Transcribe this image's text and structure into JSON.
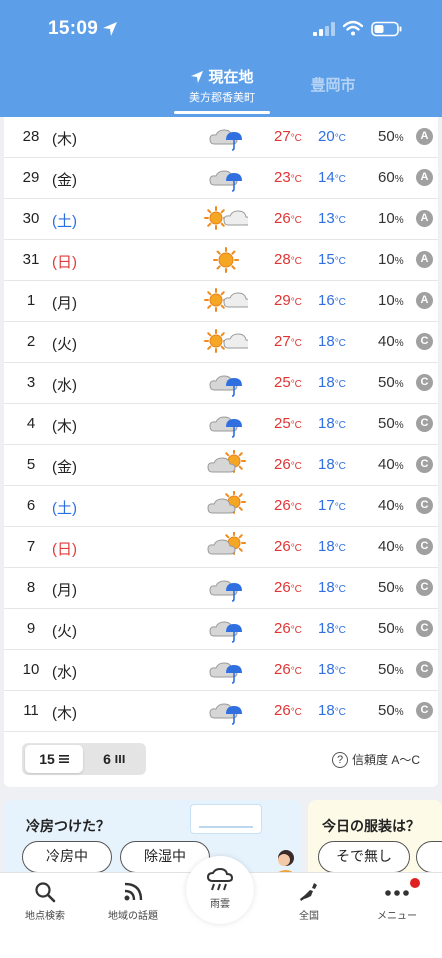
{
  "status": {
    "time": "15:09"
  },
  "header": {
    "current_tab_label": "現在地",
    "current_tab_sublabel": "美方郡香美町",
    "other_tab_label": "豊岡市"
  },
  "forecast": {
    "temp_unit": "°C",
    "pop_unit": "%",
    "rows": [
      {
        "day": "28",
        "weekday": "(木)",
        "wd": "weekday",
        "icon": "cloud-rain-icon",
        "high": "27",
        "low": "20",
        "pop": "50",
        "reliability": "A"
      },
      {
        "day": "29",
        "weekday": "(金)",
        "wd": "weekday",
        "icon": "cloud-rain-icon",
        "high": "23",
        "low": "14",
        "pop": "60",
        "reliability": "A"
      },
      {
        "day": "30",
        "weekday": "(土)",
        "wd": "sat",
        "icon": "sun-cloud-icon",
        "high": "26",
        "low": "13",
        "pop": "10",
        "reliability": "A"
      },
      {
        "day": "31",
        "weekday": "(日)",
        "wd": "sun",
        "icon": "sun-icon",
        "high": "28",
        "low": "15",
        "pop": "10",
        "reliability": "A"
      },
      {
        "day": "1",
        "weekday": "(月)",
        "wd": "weekday",
        "icon": "sun-cloud-icon",
        "high": "29",
        "low": "16",
        "pop": "10",
        "reliability": "A"
      },
      {
        "day": "2",
        "weekday": "(火)",
        "wd": "weekday",
        "icon": "sun-cloud-icon",
        "high": "27",
        "low": "18",
        "pop": "40",
        "reliability": "C"
      },
      {
        "day": "3",
        "weekday": "(水)",
        "wd": "weekday",
        "icon": "cloud-rain-icon",
        "high": "25",
        "low": "18",
        "pop": "50",
        "reliability": "C"
      },
      {
        "day": "4",
        "weekday": "(木)",
        "wd": "weekday",
        "icon": "cloud-rain-icon",
        "high": "25",
        "low": "18",
        "pop": "50",
        "reliability": "C"
      },
      {
        "day": "5",
        "weekday": "(金)",
        "wd": "weekday",
        "icon": "cloud-sun-icon",
        "high": "26",
        "low": "18",
        "pop": "40",
        "reliability": "C"
      },
      {
        "day": "6",
        "weekday": "(土)",
        "wd": "sat",
        "icon": "cloud-sun-icon",
        "high": "26",
        "low": "17",
        "pop": "40",
        "reliability": "C"
      },
      {
        "day": "7",
        "weekday": "(日)",
        "wd": "sun",
        "icon": "cloud-sun-icon",
        "high": "26",
        "low": "18",
        "pop": "40",
        "reliability": "C"
      },
      {
        "day": "8",
        "weekday": "(月)",
        "wd": "weekday",
        "icon": "cloud-rain-icon",
        "high": "26",
        "low": "18",
        "pop": "50",
        "reliability": "C"
      },
      {
        "day": "9",
        "weekday": "(火)",
        "wd": "weekday",
        "icon": "cloud-rain-icon",
        "high": "26",
        "low": "18",
        "pop": "50",
        "reliability": "C"
      },
      {
        "day": "10",
        "weekday": "(水)",
        "wd": "weekday",
        "icon": "cloud-rain-icon",
        "high": "26",
        "low": "18",
        "pop": "50",
        "reliability": "C"
      },
      {
        "day": "11",
        "weekday": "(木)",
        "wd": "weekday",
        "icon": "cloud-rain-icon",
        "high": "26",
        "low": "18",
        "pop": "50",
        "reliability": "C"
      }
    ]
  },
  "controls": {
    "toggle_15": "15",
    "toggle_6": "6",
    "reliability_label": "信頼度 A～C"
  },
  "banners": {
    "ac": {
      "title": "冷房つけた？",
      "button1": "冷房中",
      "button2": "除湿中"
    },
    "clothes": {
      "title": "今日の服装は？",
      "button1": "そで無し"
    }
  },
  "nav": {
    "search": "地点検索",
    "topics": "地域の話題",
    "rain": "雨雲",
    "national": "全国",
    "menu": "メニュー"
  },
  "colors": {
    "header_bg": "#5c9ee8",
    "high_temp": "#e03535",
    "low_temp": "#2f6fe0",
    "saturday": "#2b6ee0",
    "sunday": "#e03a3a"
  }
}
